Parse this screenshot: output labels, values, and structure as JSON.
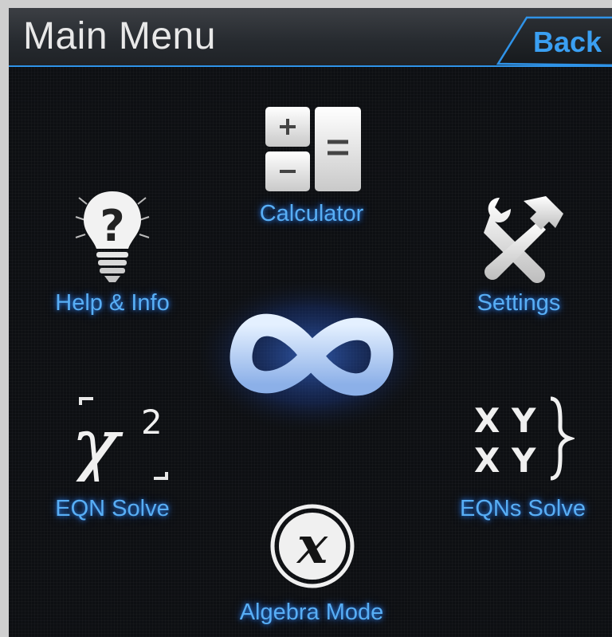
{
  "header": {
    "title": "Main Menu",
    "back_label": "Back",
    "accent_color": "#2f93e8"
  },
  "menu": {
    "calculator": {
      "label": "Calculator",
      "icon": "calculator-icon"
    },
    "help": {
      "label": "Help & Info",
      "icon": "lightbulb-question-icon"
    },
    "settings": {
      "label": "Settings",
      "icon": "wrench-hammer-icon"
    },
    "eqn_solve": {
      "label": "EQN Solve",
      "icon": "x-squared-icon",
      "icon_text": "χ",
      "icon_exp": "2"
    },
    "eqns_solve": {
      "label": "EQNs Solve",
      "icon": "xy-system-icon",
      "icon_rows": [
        "X Y",
        "X Y"
      ]
    },
    "algebra": {
      "label": "Algebra Mode",
      "icon": "x-circle-icon",
      "icon_text": "x"
    }
  },
  "center": {
    "icon": "infinity-icon"
  },
  "label_color": "#58aef5"
}
